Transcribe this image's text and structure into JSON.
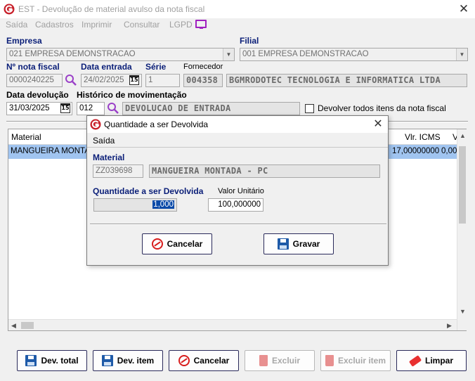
{
  "window": {
    "title": "EST - Devolução de material avulso da nota fiscal",
    "close": "✕"
  },
  "menu": [
    "Saída",
    "Cadastros",
    "Imprimir",
    "Consultar",
    "LGPD"
  ],
  "form": {
    "empresa_label": "Empresa",
    "empresa_value": "021 EMPRESA DEMONSTRACAO",
    "filial_label": "Filial",
    "filial_value": "001 EMPRESA DEMONSTRACAO",
    "nota_label": "Nº nota fiscal",
    "nota_value": "0000240225",
    "data_entrada_label": "Data entrada",
    "data_entrada_value": "24/02/2025",
    "serie_label": "Série",
    "serie_value": "1",
    "fornecedor_label": "Fornecedor",
    "fornecedor_code": "004358",
    "fornecedor_name": "BGMRODOTEC TECNOLOGIA E INFORMATICA LTDA",
    "data_devolucao_label": "Data devolução",
    "data_devolucao_value": "31/03/2025",
    "historico_label": "Histórico de movimentação",
    "historico_code": "012",
    "historico_desc": "DEVOLUCAO DE ENTRADA",
    "devolver_todos_label": "Devolver todos itens da nota fiscal",
    "calendar_glyph": "15"
  },
  "grid": {
    "columns": [
      "Material",
      "Vlr. ICMS",
      "V"
    ],
    "rows": [
      {
        "material": "MANGUEIRA MONTA",
        "vlr_icms": "17,00000000",
        "v": "0,00"
      }
    ]
  },
  "buttons": {
    "dev_total": "Dev. total",
    "dev_item": "Dev. item",
    "cancelar": "Cancelar",
    "excluir": "Excluir",
    "excluir_item": "Excluir item",
    "limpar": "Limpar"
  },
  "dialog": {
    "title": "Quantidade a ser Devolvida",
    "close": "✕",
    "menu": "Saída",
    "material_label": "Material",
    "material_code": "ZZ039698",
    "material_desc": "MANGUEIRA MONTADA - PC",
    "qty_label": "Quantidade a ser Devolvida",
    "qty_value": "1,000",
    "valor_label": "Valor Unitário",
    "valor_value": "100,000000",
    "cancel_label": "Cancelar",
    "save_label": "Gravar"
  },
  "colors": {
    "label_blue": "#0a1e78",
    "logo_red": "#c8202a",
    "selected_row": "#a0c4f0",
    "lgpd_icon": "#a020c0"
  }
}
